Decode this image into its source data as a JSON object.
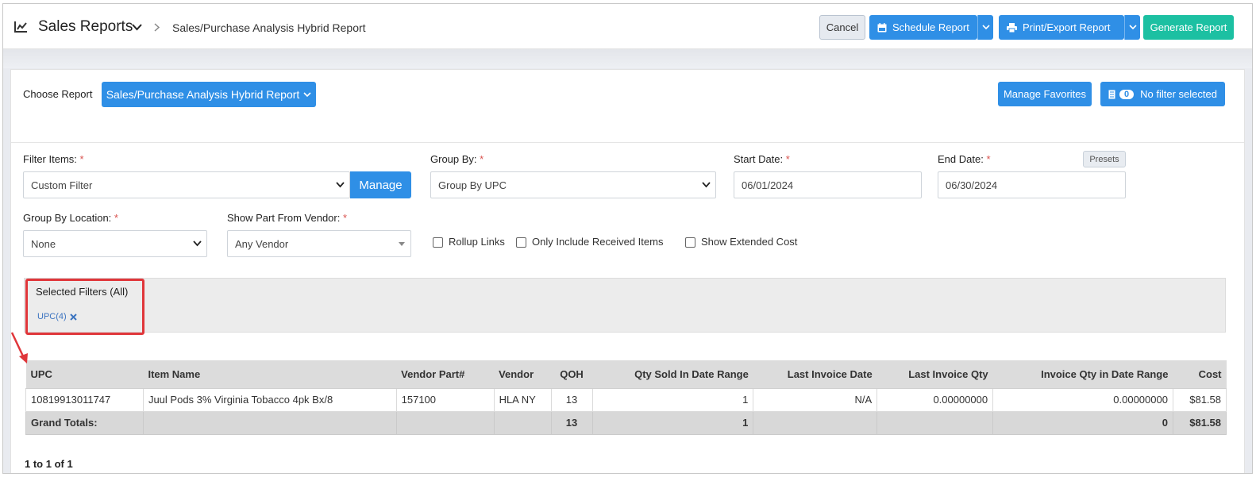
{
  "header": {
    "title": "Sales Reports",
    "breadcrumb": "Sales/Purchase Analysis Hybrid Report",
    "cancel_label": "Cancel",
    "schedule_label": "Schedule Report",
    "print_label": "Print/Export Report",
    "generate_label": "Generate Report"
  },
  "choose": {
    "label": "Choose Report",
    "selected_report": "Sales/Purchase Analysis Hybrid Report",
    "manage_favorites": "Manage Favorites",
    "filter_count": "0",
    "filter_status": "No filter selected"
  },
  "form": {
    "filter_items": {
      "label": "Filter Items:",
      "value": "Custom Filter",
      "manage_label": "Manage"
    },
    "group_by": {
      "label": "Group By:",
      "value": "Group By UPC"
    },
    "start_date": {
      "label": "Start Date:",
      "value": "06/01/2024"
    },
    "end_date": {
      "label": "End Date:",
      "value": "06/30/2024",
      "presets_label": "Presets"
    },
    "group_by_location": {
      "label": "Group By Location:",
      "value": "None"
    },
    "show_part_from_vendor": {
      "label": "Show Part From Vendor:",
      "value": "Any Vendor"
    },
    "required_mark": "*",
    "checkboxes": [
      {
        "label": "Rollup Links",
        "checked": false
      },
      {
        "label": "Only Include Received Items",
        "checked": false
      },
      {
        "label": "Show Extended Cost",
        "checked": false
      }
    ]
  },
  "selected_filters": {
    "title": "Selected Filters (All)",
    "chips": [
      {
        "label": "UPC(4)"
      }
    ]
  },
  "table": {
    "columns": [
      "UPC",
      "Item Name",
      "Vendor Part#",
      "Vendor",
      "QOH",
      "Qty Sold In Date Range",
      "Last Invoice Date",
      "Last Invoice Qty",
      "Invoice Qty in Date Range",
      "Cost"
    ],
    "rows": [
      [
        "10819913011747",
        "Juul Pods 3% Virginia Tobacco 4pk Bx/8",
        "157100",
        "HLA NY",
        "13",
        "1",
        "N/A",
        "0.00000000",
        "0.00000000",
        "$81.58"
      ]
    ],
    "totals": [
      "Grand Totals:",
      "",
      "",
      "",
      "13",
      "1",
      "",
      "",
      "0",
      "$81.58"
    ]
  },
  "pager": "1 to 1 of 1",
  "colors": {
    "primary": "#2f8fe6",
    "teal": "#1cc0a2",
    "annotation_red": "#e0363a"
  }
}
